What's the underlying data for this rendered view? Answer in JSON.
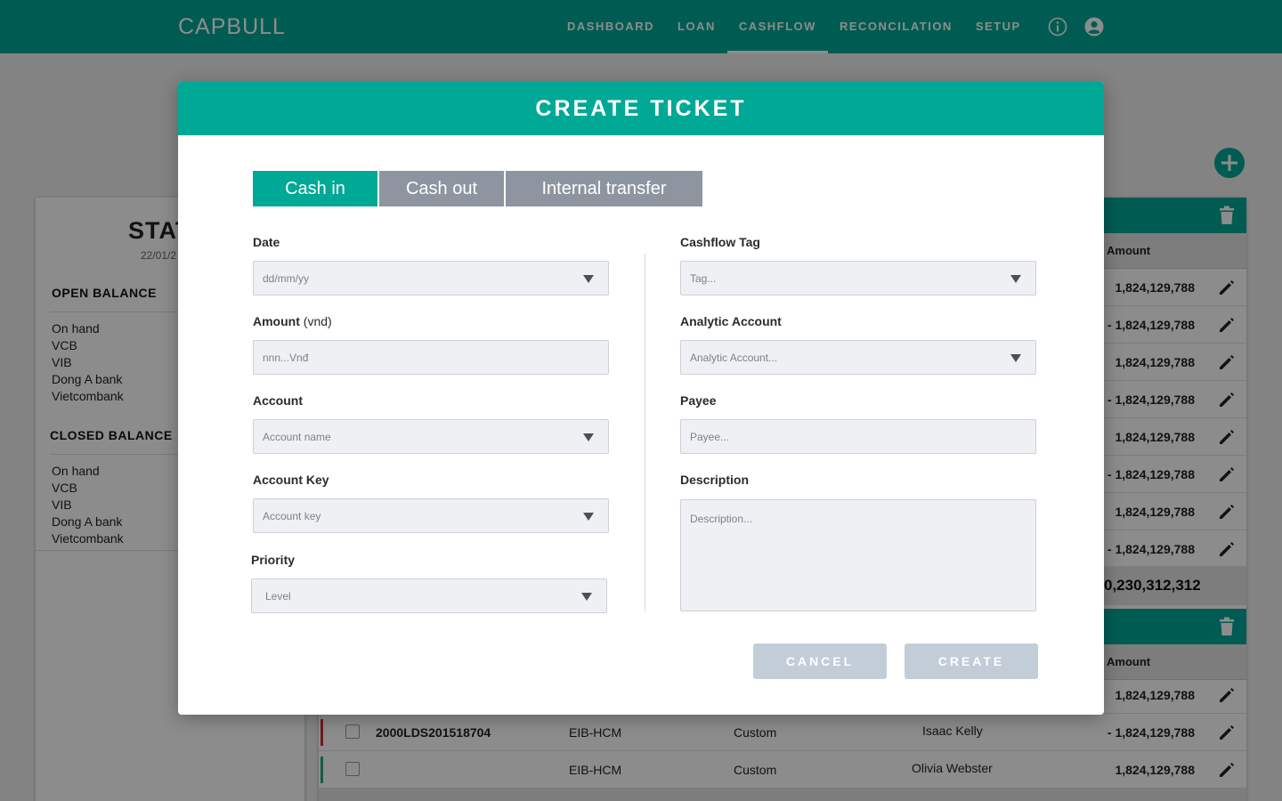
{
  "app": {
    "logo": "CAPBULL",
    "nav": [
      "DASHBOARD",
      "LOAN",
      "CASHFLOW",
      "RECONCILATION",
      "SETUP"
    ],
    "active_nav": "CASHFLOW",
    "icons": [
      "info-icon",
      "user-icon"
    ],
    "accent_color": "#00a896"
  },
  "background": {
    "stats_title": "STATIS",
    "stats_date": "22/01/2",
    "open_balance": {
      "title": "OPEN BALANCE",
      "items": [
        "On hand",
        "VCB",
        "VIB",
        "Dong A bank",
        "Vietcombank"
      ]
    },
    "closed_balance": {
      "title": "CLOSED BALANCE",
      "items": [
        "On hand",
        "VCB",
        "VIB",
        "Dong A bank",
        "Vietcombank"
      ]
    },
    "amount_header": "Amount",
    "amounts_1": [
      "1,824,129,788",
      "- 1,824,129,788",
      "1,824,129,788",
      "- 1,824,129,788",
      "1,824,129,788",
      "- 1,824,129,788",
      "1,824,129,788",
      "- 1,824,129,788"
    ],
    "total_1": "0,230,312,312",
    "amounts_2": [
      "1,824,129,788"
    ],
    "rows_2": [
      {
        "code": "2000LDS201518704",
        "branch": "EIB-HCM",
        "type": "Custom",
        "name": "Isaac Kelly",
        "amount": "- 1,824,129,788"
      },
      {
        "code": "",
        "branch": "EIB-HCM",
        "type": "Custom",
        "name": "Olivia Webster",
        "amount": "1,824,129,788"
      }
    ]
  },
  "modal": {
    "title": "CREATE TICKET",
    "tabs": [
      "Cash in",
      "Cash out",
      "Internal transfer"
    ],
    "active_tab": "Cash in",
    "left": {
      "date": {
        "label": "Date",
        "placeholder": "dd/mm/yy"
      },
      "amount": {
        "label": "Amount",
        "unit": "(vnd)",
        "placeholder": "nnn...Vnđ"
      },
      "account": {
        "label": "Account",
        "placeholder": "Account name"
      },
      "account_key": {
        "label": "Account Key",
        "placeholder": "Account key"
      },
      "priority": {
        "label": "Priority",
        "placeholder": "Level"
      }
    },
    "right": {
      "cashflow_tag": {
        "label": "Cashflow Tag",
        "placeholder": "Tag..."
      },
      "analytic_account": {
        "label": "Analytic Account",
        "placeholder": "Analytic Account..."
      },
      "payee": {
        "label": "Payee",
        "placeholder": "Payee..."
      },
      "description": {
        "label": "Description",
        "placeholder": "Description..."
      }
    },
    "buttons": {
      "cancel": "CANCEL",
      "create": "CREATE"
    }
  }
}
